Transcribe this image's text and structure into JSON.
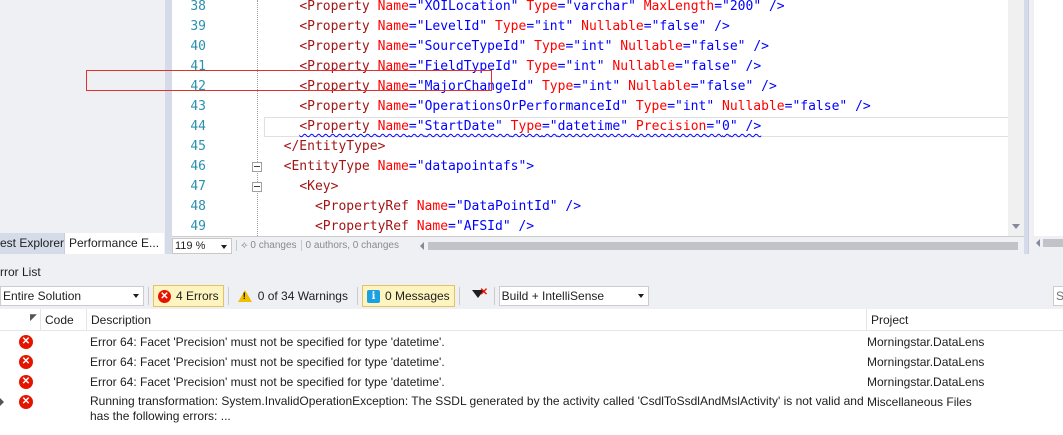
{
  "left_panel": {
    "tabs": [
      {
        "label": "est Explorer",
        "active": false
      },
      {
        "label": "Performance E...",
        "active": true
      }
    ]
  },
  "editor": {
    "lines": [
      {
        "num": "38",
        "indent": "    ",
        "parts": [
          [
            "tag",
            "<Property "
          ],
          [
            "attr",
            "Name"
          ],
          [
            "punct",
            "=\""
          ],
          [
            "val",
            "XOILocation"
          ],
          [
            "punct",
            "\" "
          ],
          [
            "attr",
            "Type"
          ],
          [
            "punct",
            "=\""
          ],
          [
            "val",
            "varchar"
          ],
          [
            "punct",
            "\" "
          ],
          [
            "attr",
            "MaxLength"
          ],
          [
            "punct",
            "=\""
          ],
          [
            "val",
            "200"
          ],
          [
            "punct",
            "\" />"
          ]
        ]
      },
      {
        "num": "39",
        "indent": "    ",
        "parts": [
          [
            "tag",
            "<Property "
          ],
          [
            "attr",
            "Name"
          ],
          [
            "punct",
            "=\""
          ],
          [
            "val",
            "LevelId"
          ],
          [
            "punct",
            "\" "
          ],
          [
            "attr",
            "Type"
          ],
          [
            "punct",
            "=\""
          ],
          [
            "val",
            "int"
          ],
          [
            "punct",
            "\" "
          ],
          [
            "attr",
            "Nullable"
          ],
          [
            "punct",
            "=\""
          ],
          [
            "val",
            "false"
          ],
          [
            "punct",
            "\" />"
          ]
        ]
      },
      {
        "num": "40",
        "indent": "    ",
        "parts": [
          [
            "tag",
            "<Property "
          ],
          [
            "attr",
            "Name"
          ],
          [
            "punct",
            "=\""
          ],
          [
            "val",
            "SourceTypeId"
          ],
          [
            "punct",
            "\" "
          ],
          [
            "attr",
            "Type"
          ],
          [
            "punct",
            "=\""
          ],
          [
            "val",
            "int"
          ],
          [
            "punct",
            "\" "
          ],
          [
            "attr",
            "Nullable"
          ],
          [
            "punct",
            "=\""
          ],
          [
            "val",
            "false"
          ],
          [
            "punct",
            "\" />"
          ]
        ]
      },
      {
        "num": "41",
        "indent": "    ",
        "parts": [
          [
            "tag",
            "<Property "
          ],
          [
            "attr",
            "Name"
          ],
          [
            "punct",
            "=\""
          ],
          [
            "val",
            "FieldTypeId"
          ],
          [
            "punct",
            "\" "
          ],
          [
            "attr",
            "Type"
          ],
          [
            "punct",
            "=\""
          ],
          [
            "val",
            "int"
          ],
          [
            "punct",
            "\" "
          ],
          [
            "attr",
            "Nullable"
          ],
          [
            "punct",
            "=\""
          ],
          [
            "val",
            "false"
          ],
          [
            "punct",
            "\" />"
          ]
        ]
      },
      {
        "num": "42",
        "indent": "    ",
        "parts": [
          [
            "tag",
            "<Property "
          ],
          [
            "attr",
            "Name"
          ],
          [
            "punct",
            "=\""
          ],
          [
            "val",
            "MajorChangeId"
          ],
          [
            "punct",
            "\" "
          ],
          [
            "attr",
            "Type"
          ],
          [
            "punct",
            "=\""
          ],
          [
            "val",
            "int"
          ],
          [
            "punct",
            "\" "
          ],
          [
            "attr",
            "Nullable"
          ],
          [
            "punct",
            "=\""
          ],
          [
            "val",
            "false"
          ],
          [
            "punct",
            "\" />"
          ]
        ]
      },
      {
        "num": "43",
        "indent": "    ",
        "parts": [
          [
            "tag",
            "<Property "
          ],
          [
            "attr",
            "Name"
          ],
          [
            "punct",
            "=\""
          ],
          [
            "val",
            "OperationsOrPerformanceId"
          ],
          [
            "punct",
            "\" "
          ],
          [
            "attr",
            "Type"
          ],
          [
            "punct",
            "=\""
          ],
          [
            "val",
            "int"
          ],
          [
            "punct",
            "\" "
          ],
          [
            "attr",
            "Nullable"
          ],
          [
            "punct",
            "=\""
          ],
          [
            "val",
            "false"
          ],
          [
            "punct",
            "\" />"
          ]
        ]
      },
      {
        "num": "44",
        "indent": "    ",
        "current": true,
        "squiggle": true,
        "parts": [
          [
            "tag",
            "<Property "
          ],
          [
            "attr",
            "Name"
          ],
          [
            "punct",
            "=\""
          ],
          [
            "val",
            "StartDate"
          ],
          [
            "punct",
            "\" "
          ],
          [
            "attr",
            "Type"
          ],
          [
            "punct",
            "=\""
          ],
          [
            "val",
            "datetime"
          ],
          [
            "punct",
            "\" "
          ],
          [
            "attr",
            "Precision"
          ],
          [
            "punct",
            "=\""
          ],
          [
            "val",
            "0"
          ],
          [
            "punct",
            "\" />"
          ]
        ]
      },
      {
        "num": "45",
        "indent": "  ",
        "parts": [
          [
            "tag",
            "</EntityType>"
          ]
        ]
      },
      {
        "num": "46",
        "indent": "  ",
        "fold": true,
        "parts": [
          [
            "tag",
            "<EntityType "
          ],
          [
            "attr",
            "Name"
          ],
          [
            "punct",
            "=\""
          ],
          [
            "val",
            "datapointafs"
          ],
          [
            "punct",
            "\">"
          ]
        ]
      },
      {
        "num": "47",
        "indent": "    ",
        "fold": true,
        "parts": [
          [
            "tag",
            "<Key>"
          ]
        ]
      },
      {
        "num": "48",
        "indent": "      ",
        "parts": [
          [
            "tag",
            "<PropertyRef "
          ],
          [
            "attr",
            "Name"
          ],
          [
            "punct",
            "=\""
          ],
          [
            "val",
            "DataPointId"
          ],
          [
            "punct",
            "\" />"
          ]
        ]
      },
      {
        "num": "49",
        "indent": "      ",
        "parts": [
          [
            "tag",
            "<PropertyRef "
          ],
          [
            "attr",
            "Name"
          ],
          [
            "punct",
            "=\""
          ],
          [
            "val",
            "AFSId"
          ],
          [
            "punct",
            "\" />"
          ]
        ]
      }
    ],
    "status": {
      "zoom": "119 %",
      "changes": "0 changes",
      "authors": "0 authors, 0 changes"
    }
  },
  "error_list": {
    "title": "rror List",
    "scope": "Entire Solution",
    "errors_btn": "4 Errors",
    "warnings_btn": "0 of 34 Warnings",
    "messages_btn": "0 Messages",
    "build_filter": "Build + IntelliSense",
    "search_placeholder": "S",
    "columns": {
      "code": "Code",
      "description": "Description",
      "project": "Project"
    },
    "rows": [
      {
        "description": "Error 64: Facet 'Precision' must not be specified for type 'datetime'.",
        "project": "Morningstar.DataLens"
      },
      {
        "description": "Error 64: Facet 'Precision' must not be specified for type 'datetime'.",
        "project": "Morningstar.DataLens"
      },
      {
        "description": "Error 64: Facet 'Precision' must not be specified for type 'datetime'.",
        "project": "Morningstar.DataLens"
      },
      {
        "description": "Running transformation: System.InvalidOperationException: The SSDL generated by the activity called 'CsdlToSsdlAndMslActivity' is not valid and has the following errors:  ...",
        "project": "Miscellaneous Files"
      }
    ]
  }
}
